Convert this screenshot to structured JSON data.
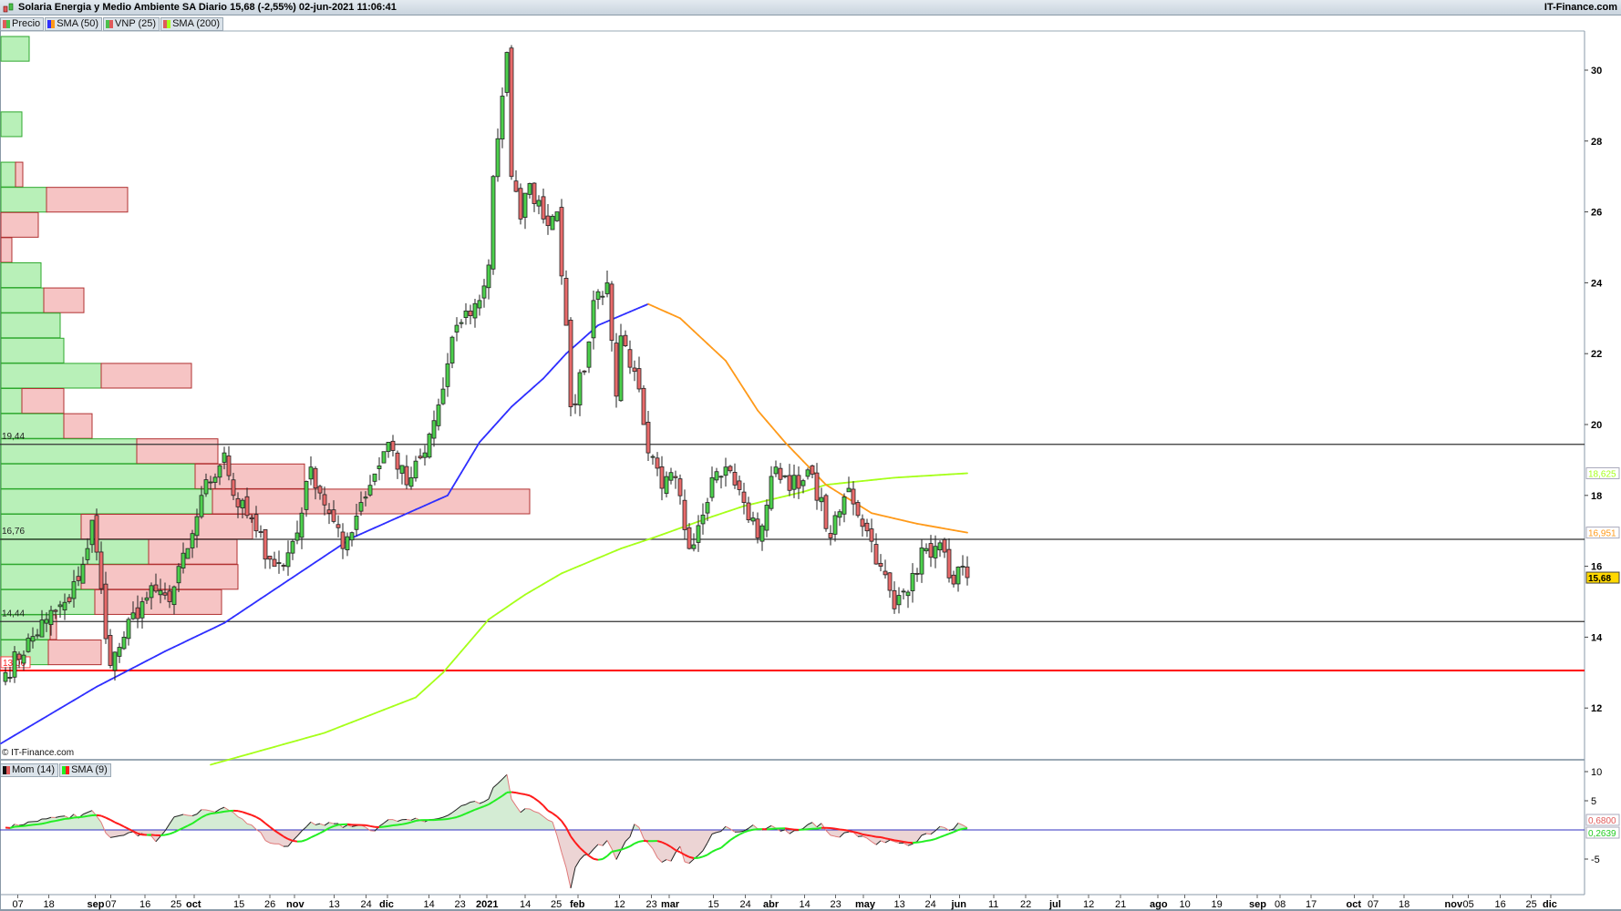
{
  "header": {
    "title": "Solaria Energia y Medio Ambiente SA Diario 15,68 (-2,55%) 02-jun-2021 11:06:41",
    "brand": "IT-Finance.com",
    "copyright": "© IT-Finance.com"
  },
  "legend_price": [
    {
      "label": "Precio",
      "colors": [
        "#e05a5a",
        "#4cc04c"
      ]
    },
    {
      "label": "SMA (50)",
      "colors": [
        "#2f2fff",
        "#ff9a1a"
      ]
    },
    {
      "label": "VNP (25)",
      "colors": [
        "#4cc04c",
        "#e05a5a"
      ]
    },
    {
      "label": "SMA (200)",
      "colors": [
        "#e05a5a",
        "#a6ff1a"
      ]
    }
  ],
  "legend_mom": [
    {
      "label": "Mom (14)",
      "colors": [
        "#111111",
        "#e05a5a"
      ]
    },
    {
      "label": "SMA (9)",
      "colors": [
        "#22ee22",
        "#ff1a1a"
      ]
    }
  ],
  "colors": {
    "up": "#4cd04c",
    "down": "#e86a6a",
    "sma50_up": "#2f2fff",
    "sma50_down": "#ff9a1a",
    "sma200": "#a6ff1a",
    "support": "#ff0000",
    "level": "#333333",
    "zero": "#3030c0"
  },
  "chart_data": [
    {
      "type": "candlestick",
      "title": "Solaria Energia y Medio Ambiente SA Diario",
      "last": "15,68",
      "change": "-2,55%",
      "ylim": [
        10.5,
        31.5
      ],
      "yticks": [
        12,
        14,
        16,
        18,
        20,
        22,
        24,
        26,
        28,
        30
      ],
      "price_close_anchors": [
        [
          0,
          13.0
        ],
        [
          9,
          14.5
        ],
        [
          14,
          15.0
        ],
        [
          18,
          16.5
        ],
        [
          19,
          17.3
        ],
        [
          23,
          13.2
        ],
        [
          26,
          14.0
        ],
        [
          30,
          15.0
        ],
        [
          33,
          15.3
        ],
        [
          36,
          15.0
        ],
        [
          40,
          16.5
        ],
        [
          43,
          18.0
        ],
        [
          48,
          19.2
        ],
        [
          50,
          18.0
        ],
        [
          55,
          17.0
        ],
        [
          58,
          16.2
        ],
        [
          61,
          16.0
        ],
        [
          65,
          17.5
        ],
        [
          67,
          18.8
        ],
        [
          71,
          17.5
        ],
        [
          74,
          16.5
        ],
        [
          78,
          17.8
        ],
        [
          84,
          19.5
        ],
        [
          88,
          18.3
        ],
        [
          92,
          19.2
        ],
        [
          96,
          21.0
        ],
        [
          99,
          22.8
        ],
        [
          104,
          23.5
        ],
        [
          106,
          24.5
        ],
        [
          107,
          27.0
        ],
        [
          110,
          30.5
        ],
        [
          111,
          27.0
        ],
        [
          113,
          25.8
        ],
        [
          115,
          26.8
        ],
        [
          118,
          25.8
        ],
        [
          121,
          26.0
        ],
        [
          123,
          22.8
        ],
        [
          124,
          20.5
        ],
        [
          127,
          21.5
        ],
        [
          129,
          23.5
        ],
        [
          132,
          24.0
        ],
        [
          134,
          20.8
        ],
        [
          135,
          22.5
        ],
        [
          138,
          21.5
        ],
        [
          140,
          20.0
        ],
        [
          141,
          19.2
        ],
        [
          144,
          18.2
        ],
        [
          147,
          18.5
        ],
        [
          150,
          16.5
        ],
        [
          155,
          18.5
        ],
        [
          158,
          18.8
        ],
        [
          162,
          17.8
        ],
        [
          165,
          16.8
        ],
        [
          169,
          18.8
        ],
        [
          174,
          18.2
        ],
        [
          177,
          18.6
        ],
        [
          181,
          16.8
        ],
        [
          185,
          18.2
        ],
        [
          189,
          17.0
        ],
        [
          192,
          16.0
        ],
        [
          195,
          14.8
        ],
        [
          199,
          15.8
        ],
        [
          202,
          16.5
        ],
        [
          206,
          16.4
        ],
        [
          208,
          15.5
        ],
        [
          210,
          16.0
        ],
        [
          211,
          15.68
        ]
      ],
      "sma50_anchors": [
        [
          -1,
          11.0
        ],
        [
          20,
          12.6
        ],
        [
          35,
          13.6
        ],
        [
          48,
          14.4
        ],
        [
          62,
          15.6
        ],
        [
          76,
          16.8
        ],
        [
          90,
          17.6
        ],
        [
          97,
          18.0
        ],
        [
          104,
          19.5
        ],
        [
          111,
          20.5
        ],
        [
          118,
          21.3
        ],
        [
          123,
          22.0
        ],
        [
          130,
          22.8
        ],
        [
          141,
          23.4
        ],
        [
          148,
          23.0
        ],
        [
          158,
          21.8
        ],
        [
          165,
          20.4
        ],
        [
          171,
          19.5
        ],
        [
          180,
          18.3
        ],
        [
          190,
          17.5
        ],
        [
          200,
          17.2
        ],
        [
          211,
          16.951
        ]
      ],
      "sma200_anchors": [
        [
          45,
          10.4
        ],
        [
          70,
          11.3
        ],
        [
          90,
          12.3
        ],
        [
          96,
          13.0
        ],
        [
          106,
          14.5
        ],
        [
          114,
          15.2
        ],
        [
          122,
          15.8
        ],
        [
          135,
          16.5
        ],
        [
          142,
          16.8
        ],
        [
          155,
          17.4
        ],
        [
          162,
          17.7
        ],
        [
          175,
          18.1
        ],
        [
          180,
          18.3
        ],
        [
          195,
          18.5
        ],
        [
          211,
          18.625
        ]
      ],
      "levels": [
        {
          "label": "19,44",
          "value": 19.44
        },
        {
          "label": "16,76",
          "value": 16.76
        },
        {
          "label": "14,44",
          "value": 14.44
        },
        {
          "label": "13,06",
          "value": 13.06,
          "support": true
        }
      ],
      "last_labels": [
        {
          "label": "18,625",
          "value": 18.625,
          "series": "SMA (200)"
        },
        {
          "label": "16,951",
          "value": 16.951,
          "series": "SMA (50)"
        },
        {
          "label": "15,68",
          "value": 15.68,
          "series": "Precio"
        }
      ],
      "volume_profile": {
        "top": 30.95,
        "bin_size": 0.7096,
        "bins_up_down": [
          [
            31,
            0
          ],
          [
            0,
            0
          ],
          [
            0,
            0
          ],
          [
            23,
            0
          ],
          [
            0,
            0
          ],
          [
            16,
            8
          ],
          [
            50,
            89
          ],
          [
            0,
            41
          ],
          [
            0,
            12
          ],
          [
            44,
            0
          ],
          [
            47,
            44
          ],
          [
            65,
            0
          ],
          [
            69,
            0
          ],
          [
            110,
            99
          ],
          [
            23,
            46
          ],
          [
            69,
            31
          ],
          [
            149,
            89
          ],
          [
            213,
            120
          ],
          [
            232,
            348
          ],
          [
            88,
            188
          ],
          [
            162,
            97
          ],
          [
            88,
            172
          ],
          [
            103,
            139
          ],
          [
            54,
            7
          ],
          [
            52,
            58
          ]
        ]
      }
    },
    {
      "type": "line",
      "title": "Mom (14) / SMA (9)",
      "ylim": [
        -11,
        11
      ],
      "yticks": [
        {
          "v": 10,
          "label": "10"
        },
        {
          "v": 5,
          "label": "5"
        },
        {
          "v": -5,
          "label": "-5"
        }
      ],
      "momentum_period": 14,
      "signal_period": 9,
      "last_labels": [
        {
          "label": "0,6800",
          "value": 0.68,
          "color": "#e05a5a"
        },
        {
          "label": "0,2639",
          "value": 0.2639,
          "color": "#22cc22"
        }
      ]
    }
  ],
  "x_axis": {
    "ticks": [
      {
        "x": 3.1,
        "label": "07"
      },
      {
        "x": 9.9,
        "label": "18"
      },
      {
        "x": 20.1,
        "label": "sep",
        "bold": true
      },
      {
        "x": 23.5,
        "label": "07"
      },
      {
        "x": 31.0,
        "label": "16"
      },
      {
        "x": 37.8,
        "label": "25"
      },
      {
        "x": 41.8,
        "label": "oct",
        "bold": true
      },
      {
        "x": 51.6,
        "label": "15"
      },
      {
        "x": 58.4,
        "label": "26"
      },
      {
        "x": 63.8,
        "label": "nov",
        "bold": true
      },
      {
        "x": 72.5,
        "label": "13"
      },
      {
        "x": 79.5,
        "label": "24"
      },
      {
        "x": 84.2,
        "label": "dic",
        "bold": true
      },
      {
        "x": 93.3,
        "label": "14"
      },
      {
        "x": 100.1,
        "label": "23"
      },
      {
        "x": 106.0,
        "label": "2021",
        "bold": true
      },
      {
        "x": 114.4,
        "label": "14"
      },
      {
        "x": 121.2,
        "label": "25"
      },
      {
        "x": 126.0,
        "label": "feb",
        "bold": true
      },
      {
        "x": 135.1,
        "label": "12"
      },
      {
        "x": 142.1,
        "label": "23"
      },
      {
        "x": 146.0,
        "label": "mar",
        "bold": true
      },
      {
        "x": 155.7,
        "label": "15"
      },
      {
        "x": 162.7,
        "label": "24"
      },
      {
        "x": 168.4,
        "label": "abr",
        "bold": true
      },
      {
        "x": 175.7,
        "label": "14"
      },
      {
        "x": 182.5,
        "label": "23"
      },
      {
        "x": 188.6,
        "label": "may",
        "bold": true
      },
      {
        "x": 196.5,
        "label": "13"
      },
      {
        "x": 203.3,
        "label": "24"
      },
      {
        "x": 209.7,
        "label": "jun",
        "bold": true
      },
      {
        "x": 217.2,
        "label": "11"
      },
      {
        "x": 224.2,
        "label": "22"
      },
      {
        "x": 231.2,
        "label": "jul",
        "bold": true
      },
      {
        "x": 238.0,
        "label": "12"
      },
      {
        "x": 245.0,
        "label": "21"
      },
      {
        "x": 253.2,
        "label": "ago",
        "bold": true
      },
      {
        "x": 259.1,
        "label": "10"
      },
      {
        "x": 266.1,
        "label": "19"
      },
      {
        "x": 275.0,
        "label": "sep",
        "bold": true
      },
      {
        "x": 280.0,
        "label": "08"
      },
      {
        "x": 286.8,
        "label": "17"
      },
      {
        "x": 296.3,
        "label": "oct",
        "bold": true
      },
      {
        "x": 300.4,
        "label": "07"
      },
      {
        "x": 307.2,
        "label": "18"
      },
      {
        "x": 317.9,
        "label": "nov",
        "bold": true
      },
      {
        "x": 321.3,
        "label": "05"
      },
      {
        "x": 328.3,
        "label": "16"
      },
      {
        "x": 335.1,
        "label": "25"
      },
      {
        "x": 339.4,
        "label": "dic",
        "bold": true
      }
    ]
  }
}
